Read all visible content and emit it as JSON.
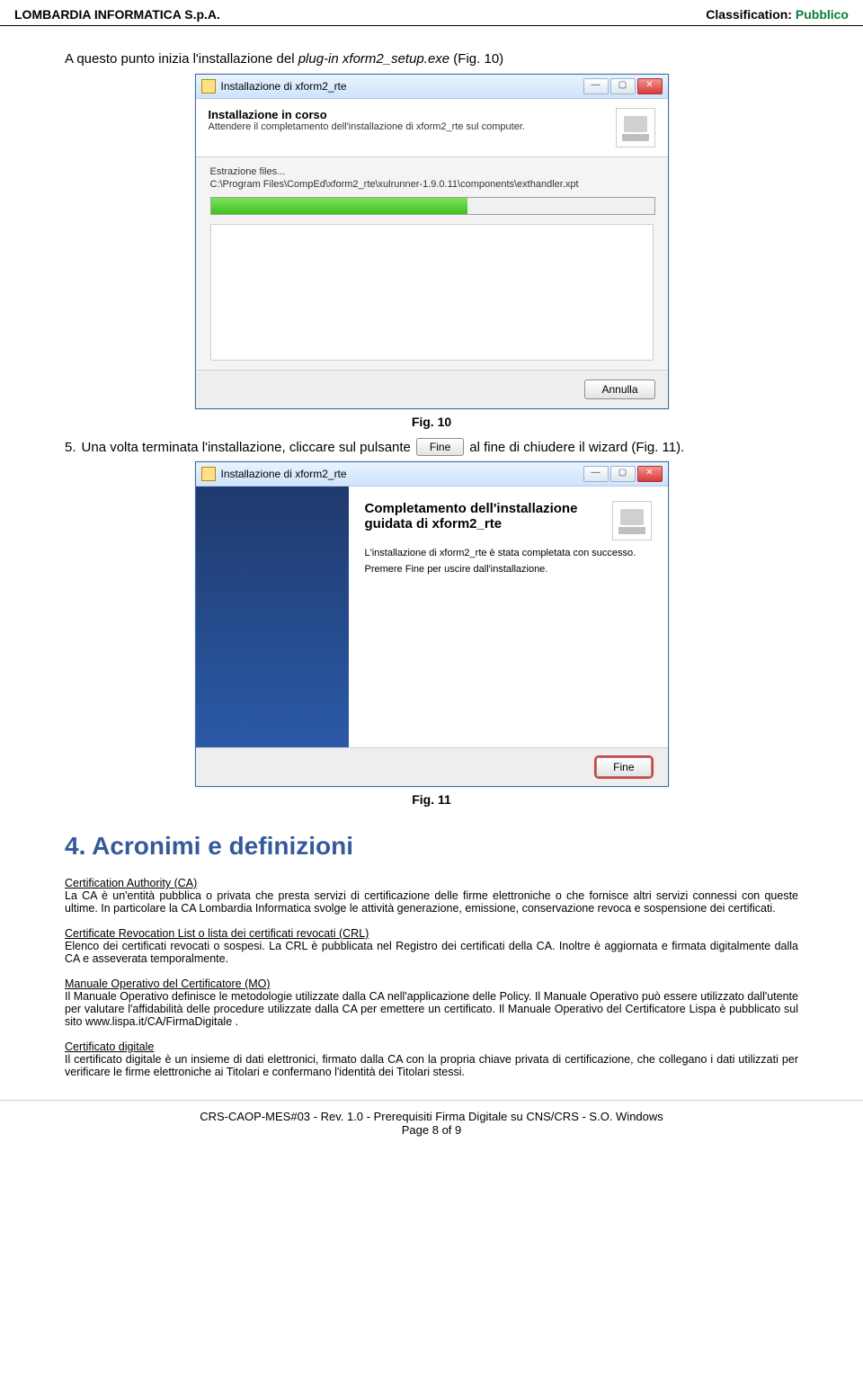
{
  "header": {
    "left": "LOMBARDIA INFORMATICA S.p.A.",
    "right_label": "Classification: ",
    "right_value": "Pubblico"
  },
  "intro": {
    "prefix": "A questo punto inizia l'installazione del ",
    "italic": "plug-in xform2_setup.exe",
    "suffix": " (Fig. 10)"
  },
  "fig10": {
    "title": "Installazione di xform2_rte",
    "h_title": "Installazione in corso",
    "h_sub": "Attendere il completamento dell'installazione di xform2_rte sul computer.",
    "extract_label": "Estrazione files...",
    "path": "C:\\Program Files\\CompEd\\xform2_rte\\xulrunner-1.9.0.11\\components\\exthandler.xpt",
    "cancel": "Annulla",
    "caption": "Fig. 10"
  },
  "step5": {
    "num": "5.",
    "before": "Una volta terminata l'installazione, cliccare sul pulsante ",
    "btn": "Fine",
    "after": " al fine di chiudere il wizard (Fig. 11)."
  },
  "fig11": {
    "title": "Installazione di xform2_rte",
    "heading": "Completamento dell'installazione guidata di xform2_rte",
    "line1": "L'installazione di xform2_rte è stata completata con successo.",
    "line2": "Premere Fine per uscire dall'installazione.",
    "fine": "Fine",
    "caption": "Fig. 11"
  },
  "section_heading": "4.  Acronimi e definizioni",
  "defs": {
    "ca_title": "Certification Authority (CA)",
    "ca_body": "La CA è un'entità pubblica o privata che presta servizi di certificazione delle firme elettroniche o che fornisce altri servizi connessi con queste ultime. In particolare la CA Lombardia Informatica svolge le attività generazione, emissione, conservazione revoca e sospensione dei certificati.",
    "crl_title": "Certificate Revocation List o lista dei certificati revocati (CRL)",
    "crl_body": "Elenco dei certificati revocati o sospesi. La CRL è pubblicata nel Registro dei certificati della CA. Inoltre è aggiornata e firmata digitalmente dalla CA e asseverata temporalmente.",
    "mo_title": "Manuale Operativo del Certificatore (MO)",
    "mo_body": "Il Manuale Operativo definisce le metodologie utilizzate dalla CA nell'applicazione delle Policy. Il Manuale Operativo può essere utilizzato dall'utente per valutare l'affidabilità delle procedure utilizzate dalla CA per emettere un certificato. Il Manuale Operativo del Certificatore Lispa è pubblicato sul sito www.lispa.it/CA/FirmaDigitale .",
    "cd_title": "Certificato digitale",
    "cd_body": "Il certificato digitale è un insieme di dati elettronici, firmato dalla CA con la propria chiave privata di certificazione, che collegano i dati utilizzati per verificare le firme elettroniche ai Titolari e confermano l'identità dei Titolari stessi."
  },
  "footer": {
    "line1": "CRS-CAOP-MES#03 - Rev. 1.0 - Prerequisiti Firma Digitale su CNS/CRS - S.O. Windows",
    "line2": "Page 8 of 9"
  }
}
